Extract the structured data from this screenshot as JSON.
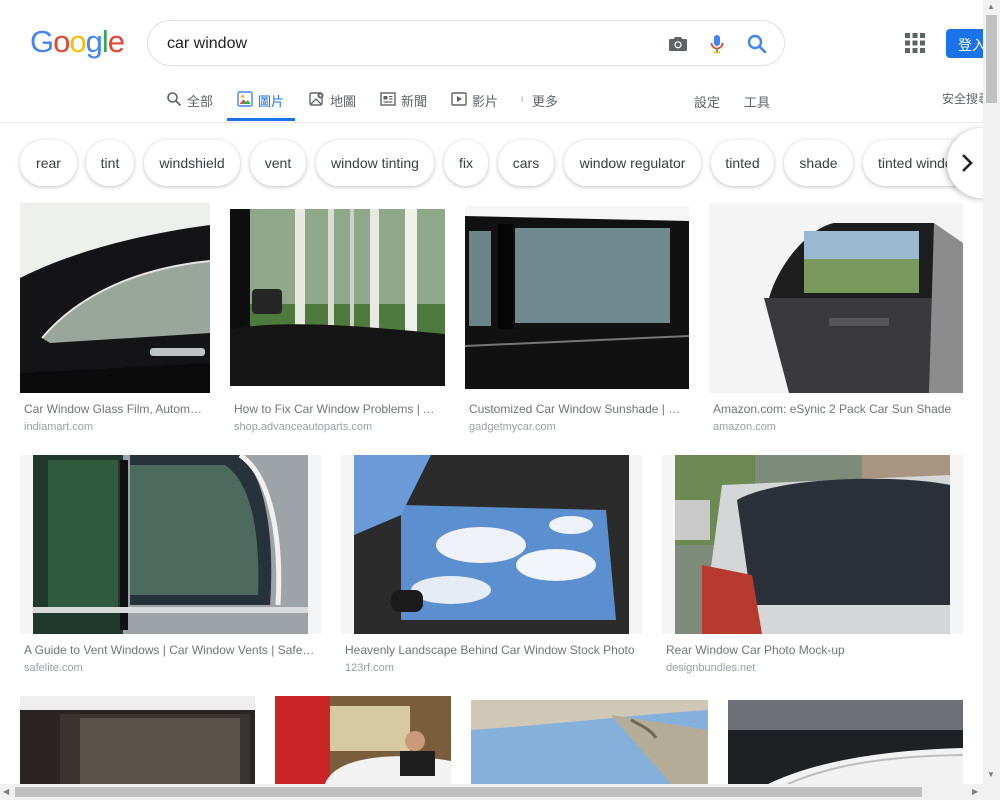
{
  "logo": "Google",
  "search": {
    "query": "car window"
  },
  "header": {
    "sign_in": "登入"
  },
  "tabs": [
    {
      "label": "全部"
    },
    {
      "label": "圖片"
    },
    {
      "label": "地圖"
    },
    {
      "label": "新聞"
    },
    {
      "label": "影片"
    },
    {
      "label": "更多"
    }
  ],
  "tools": {
    "settings": "設定",
    "tools": "工具",
    "safe_search": "安全搜尋"
  },
  "chips": [
    "rear",
    "tint",
    "windshield",
    "vent",
    "window tinting",
    "fix",
    "cars",
    "window regulator",
    "tinted",
    "shade",
    "tinted window"
  ],
  "results": [
    {
      "title": "Car Window Glass Film, Automotive Window Film",
      "domain": "indiamart.com"
    },
    {
      "title": "How to Fix Car Window Problems | Advance Auto Parts",
      "domain": "shop.advanceautoparts.com"
    },
    {
      "title": "Customized Car Window Sunshade | GadgetMyCar",
      "domain": "gadgetmycar.com"
    },
    {
      "title": "Amazon.com: eSynic 2 Pack Car Sun Shade",
      "domain": "amazon.com"
    },
    {
      "title": "A Guide to Vent Windows | Car Window Vents | Safelite",
      "domain": "safelite.com"
    },
    {
      "title": "Heavenly Landscape Behind Car Window Stock Photo",
      "domain": "123rf.com"
    },
    {
      "title": "Rear Window Car Photo Mock-up",
      "domain": "designbundles.net"
    }
  ],
  "colors": {
    "accent": "#1a73e8",
    "blue": "#4285f4",
    "red": "#ea4335",
    "yellow": "#fbbc05",
    "green": "#34a853"
  }
}
